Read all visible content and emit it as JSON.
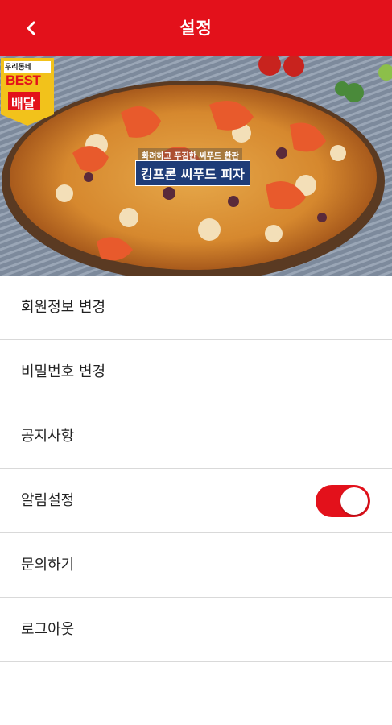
{
  "header": {
    "title": "설정",
    "back_icon": "chevron-left-icon",
    "color": "#e3111b"
  },
  "banner": {
    "badge_top": "우리동네",
    "badge_best": "BEST",
    "badge_deal": "배달",
    "promo_sub": "화려하고 푸짐한 씨푸드 한판",
    "promo_main": "킹프론 씨푸드 피자"
  },
  "menu": {
    "items": [
      {
        "label": "회원정보 변경"
      },
      {
        "label": "비밀번호 변경"
      },
      {
        "label": "공지사항"
      },
      {
        "label": "알림설정",
        "toggle": true
      },
      {
        "label": "문의하기"
      },
      {
        "label": "로그아웃"
      }
    ],
    "toggle_color": "#e3111b"
  }
}
